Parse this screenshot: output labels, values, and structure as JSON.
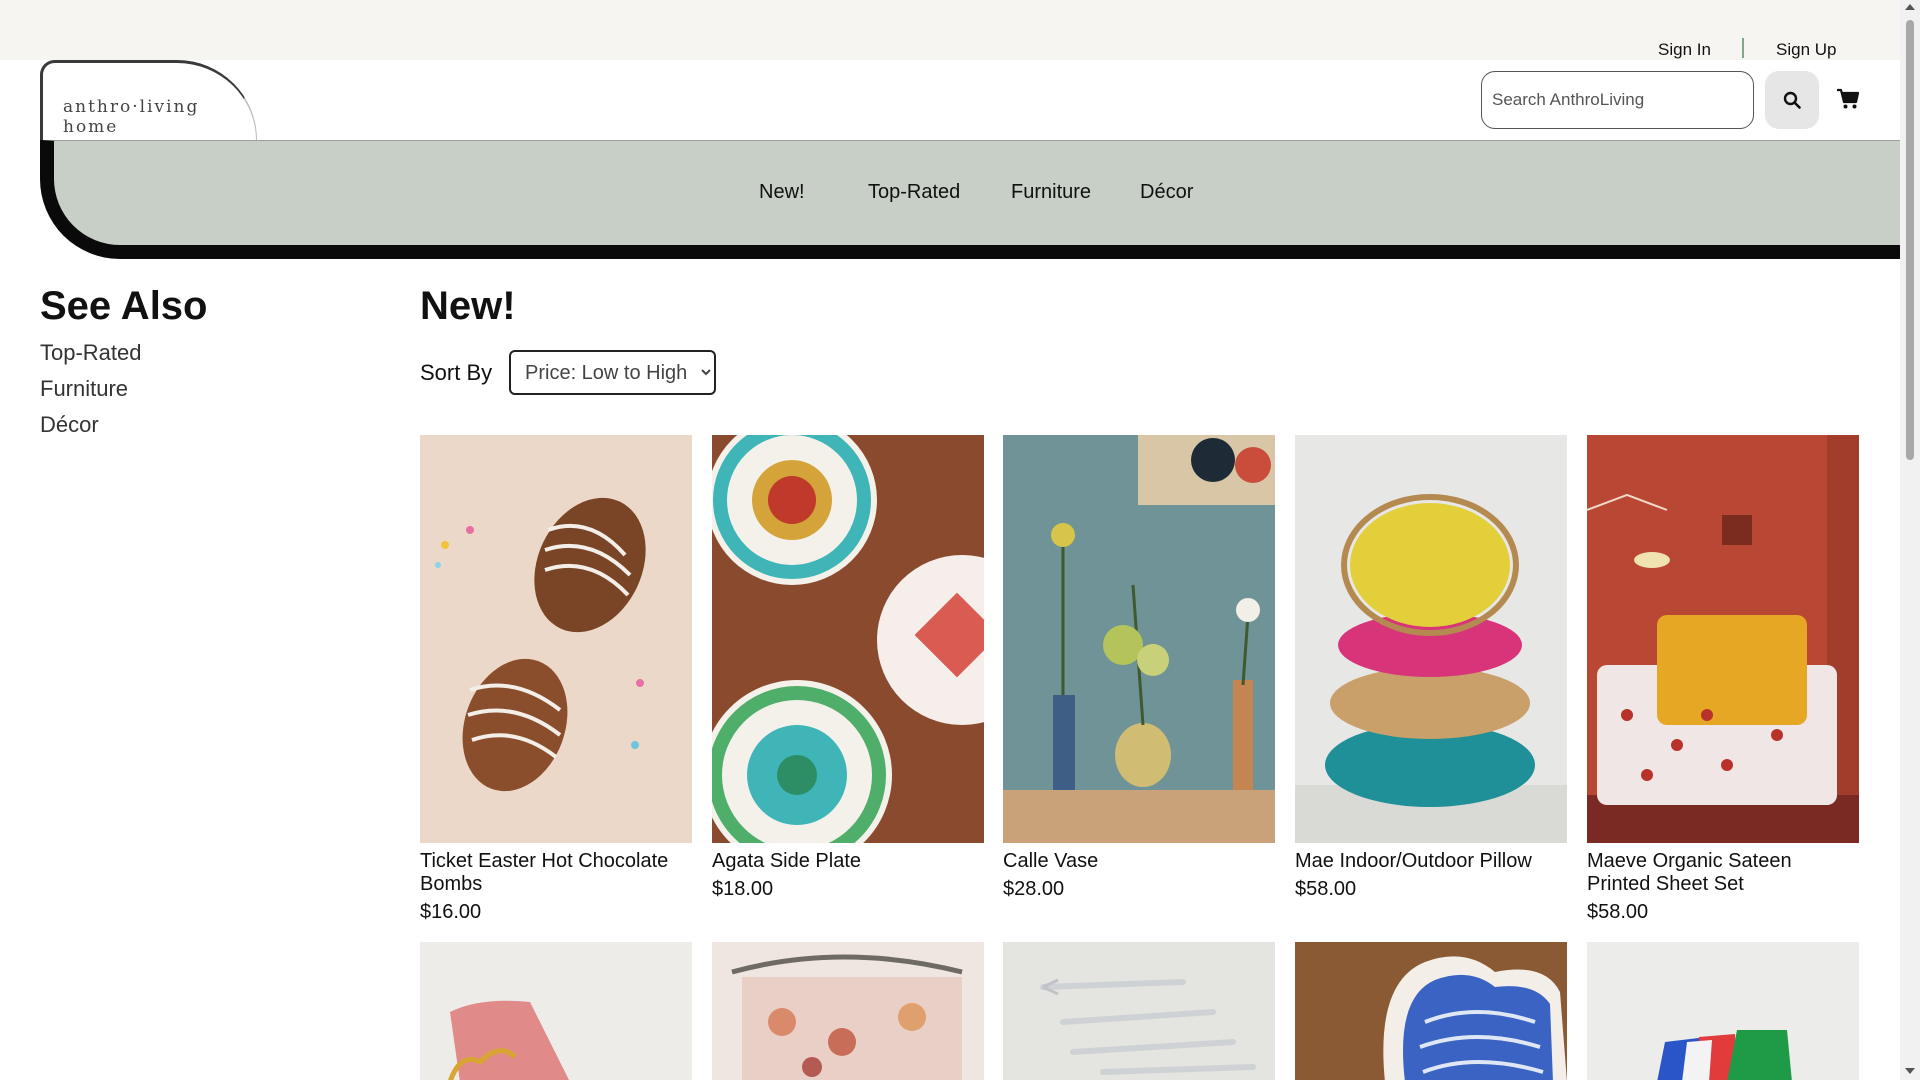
{
  "header": {
    "sign_in": "Sign In",
    "sign_up": "Sign Up",
    "logo_text": "anthro·living home",
    "search_placeholder": "Search AnthroLiving",
    "icons": [
      "search-icon",
      "cart-icon"
    ]
  },
  "nav": {
    "items": [
      {
        "label": "New!"
      },
      {
        "label": "Top-Rated"
      },
      {
        "label": "Furniture"
      },
      {
        "label": "Décor"
      }
    ],
    "band_color": "#c7cfc6"
  },
  "sidebar": {
    "title": "See Also",
    "links": [
      {
        "label": "Top-Rated"
      },
      {
        "label": "Furniture"
      },
      {
        "label": "Décor"
      }
    ]
  },
  "main": {
    "title": "New!",
    "sort_label": "Sort By",
    "sort_selected": "Price: Low to High",
    "products": [
      {
        "name": "Ticket Easter Hot Chocolate Bombs",
        "price": "$16.00"
      },
      {
        "name": "Agata Side Plate",
        "price": "$18.00"
      },
      {
        "name": "Calle Vase",
        "price": "$28.00"
      },
      {
        "name": "Mae Indoor/Outdoor Pillow",
        "price": "$58.00"
      },
      {
        "name": "Maeve Organic Sateen Printed Sheet Set",
        "price": "$58.00"
      }
    ]
  }
}
